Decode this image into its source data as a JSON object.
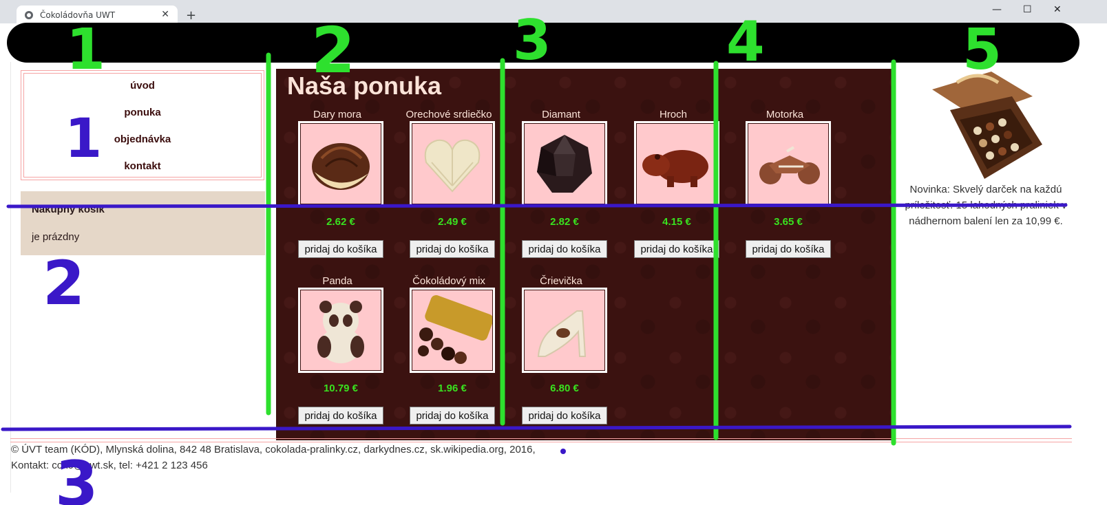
{
  "browser": {
    "tab_title": "Čokoládovňa UWT",
    "new_tab": "+",
    "minimize": "—",
    "maximize": "☐",
    "close": "✕",
    "tab_close": "✕"
  },
  "nav": {
    "items": [
      {
        "label": "úvod"
      },
      {
        "label": "ponuka"
      },
      {
        "label": "objednávka"
      },
      {
        "label": "kontakt"
      }
    ]
  },
  "cart": {
    "title": "Nákupný košík",
    "status": "je prázdny"
  },
  "main": {
    "title": "Naša ponuka",
    "button_label": "pridaj do košíka",
    "products": [
      {
        "name": "Dary mora",
        "price": "2.62 €",
        "shape": "shell",
        "color": "#5a2a16"
      },
      {
        "name": "Orechové srdiečko",
        "price": "2.49 €",
        "shape": "heart",
        "color": "#efe6c8"
      },
      {
        "name": "Diamant",
        "price": "2.82 €",
        "shape": "gem",
        "color": "#2a1a1c"
      },
      {
        "name": "Hroch",
        "price": "4.15 €",
        "shape": "hippo",
        "color": "#7a2412"
      },
      {
        "name": "Motorka",
        "price": "3.65 €",
        "shape": "moto",
        "color": "#8a4a30"
      },
      {
        "name": "Panda",
        "price": "10.79 €",
        "shape": "panda",
        "color": "#4a2a22"
      },
      {
        "name": "Čokoládový mix",
        "price": "1.96 €",
        "shape": "mix",
        "color": "#c89a2a"
      },
      {
        "name": "Črievička",
        "price": "6.80 €",
        "shape": "shoe",
        "color": "#f1e8d6"
      }
    ]
  },
  "aside": {
    "text": "Novinka: Skvelý darček na každú príležitosť. 15 lahodných praliniek v nádhernom balení len za 10,99 €."
  },
  "footer": {
    "line1": "© ÚVT team (KÓD), Mlynská dolina, 842 48 Bratislava, cokolada-pralinky.cz, darkydnes.cz, sk.wikipedia.org, 2016,",
    "line2": "Kontakt: coko@uwt.sk, tel: +421 2 123 456"
  },
  "annotations": {
    "green_numbers": [
      "1",
      "2",
      "3",
      "4",
      "5"
    ],
    "blue_numbers": [
      "1",
      "2",
      "3"
    ],
    "green_color": "#2ee02e",
    "blue_color": "#3a18c8"
  }
}
